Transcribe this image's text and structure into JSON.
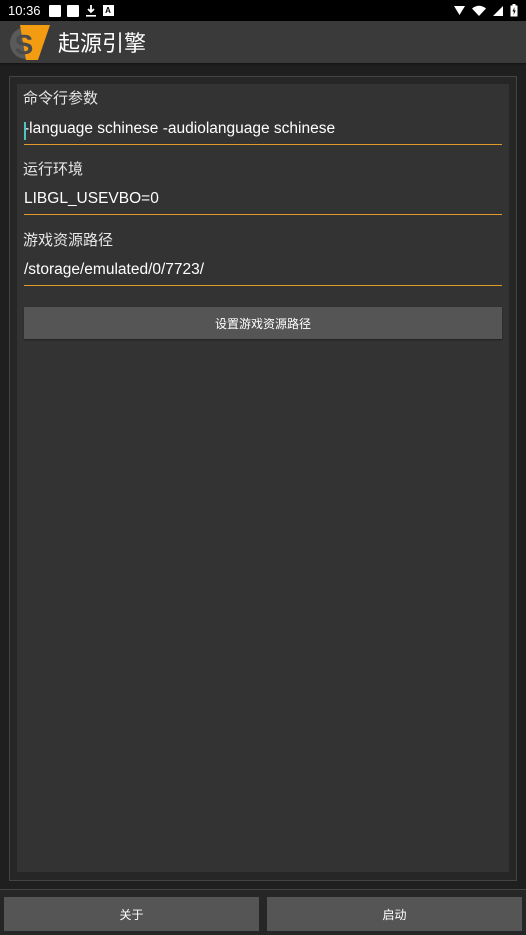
{
  "status_bar": {
    "time": "10:36",
    "notification_letter": "A"
  },
  "app_bar": {
    "title": "起源引擎",
    "logo_letter": "S",
    "accent_color": "#f39c12"
  },
  "form": {
    "command_line": {
      "label": "命令行参数",
      "value": "-language schinese -audiolanguage schinese"
    },
    "environment": {
      "label": "运行环境",
      "value": "LIBGL_USEVBO=0"
    },
    "game_path": {
      "label": "游戏资源路径",
      "value": "/storage/emulated/0/7723/"
    },
    "set_path_button": "设置游戏资源路径"
  },
  "bottom_bar": {
    "about_button": "关于",
    "launch_button": "启动"
  },
  "colors": {
    "underline": "#e29a2b",
    "cursor": "#4fc3c0",
    "button_bg": "#555555"
  }
}
